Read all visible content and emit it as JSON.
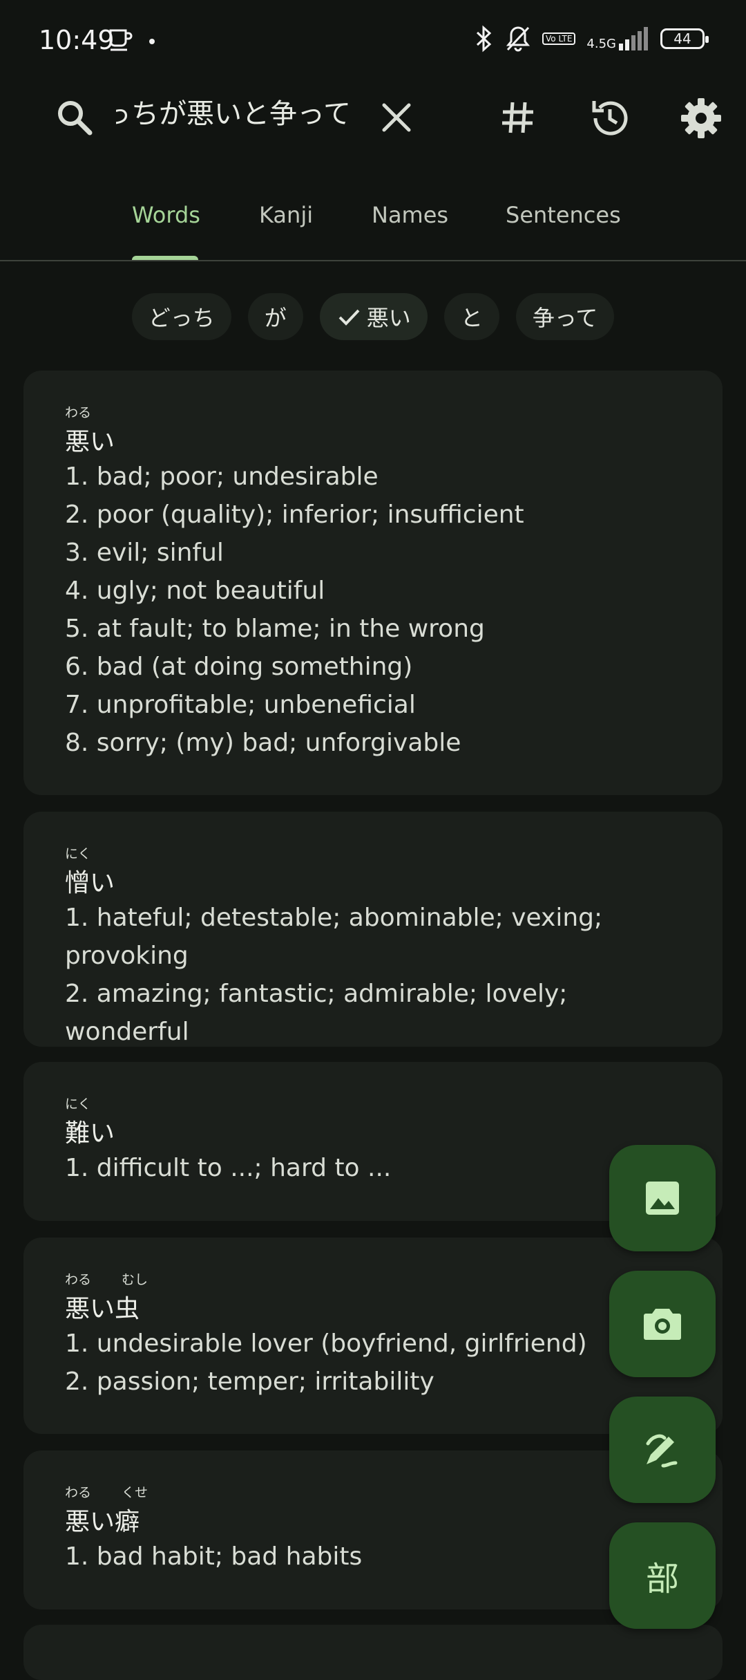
{
  "status": {
    "time": "10:49",
    "network": "4.5G",
    "volte": "Vo LTE",
    "battery": "44"
  },
  "search": {
    "query": "どっちが悪いと争って"
  },
  "tabs": [
    "Words",
    "Kanji",
    "Names",
    "Sentences"
  ],
  "active_tab": "Words",
  "chips": [
    {
      "label": "どっち",
      "selected": false
    },
    {
      "label": "が",
      "selected": false
    },
    {
      "label": "悪い",
      "selected": true
    },
    {
      "label": "と",
      "selected": false
    },
    {
      "label": "争って",
      "selected": false
    }
  ],
  "results": [
    {
      "furigana": [
        "わる"
      ],
      "word": "悪い",
      "definitions": [
        "1. bad; poor; undesirable",
        "2. poor (quality); inferior; insufficient",
        "3. evil; sinful",
        "4. ugly; not beautiful",
        "5. at fault; to blame; in the wrong",
        "6. bad (at doing something)",
        "7. unprofitable; unbeneficial",
        "8. sorry; (my) bad; unforgivable"
      ]
    },
    {
      "furigana": [
        "にく"
      ],
      "word": "憎い",
      "definitions": [
        "1. hateful; detestable; abominable; vexing; provoking",
        "2. amazing; fantastic; admirable; lovely; wonderful"
      ]
    },
    {
      "furigana": [
        "にく"
      ],
      "word": "難い",
      "definitions": [
        "1. difficult to ...; hard to ..."
      ]
    },
    {
      "furigana": [
        "わる",
        "むし"
      ],
      "word": "悪い虫",
      "definitions": [
        "1. undesirable lover (boyfriend, girlfriend)",
        "2. passion; temper; irritability"
      ]
    },
    {
      "furigana": [
        "わる",
        "くせ"
      ],
      "word": "悪い癖",
      "definitions": [
        "1. bad habit; bad habits"
      ]
    }
  ],
  "fabs": {
    "image": "image-icon",
    "camera": "camera-icon",
    "handwriting": "handwriting-icon",
    "radical_label": "部"
  },
  "colors": {
    "accent": "#a5d497",
    "background": "#111411",
    "card": "#1b1f1b",
    "fab": "#255023"
  }
}
